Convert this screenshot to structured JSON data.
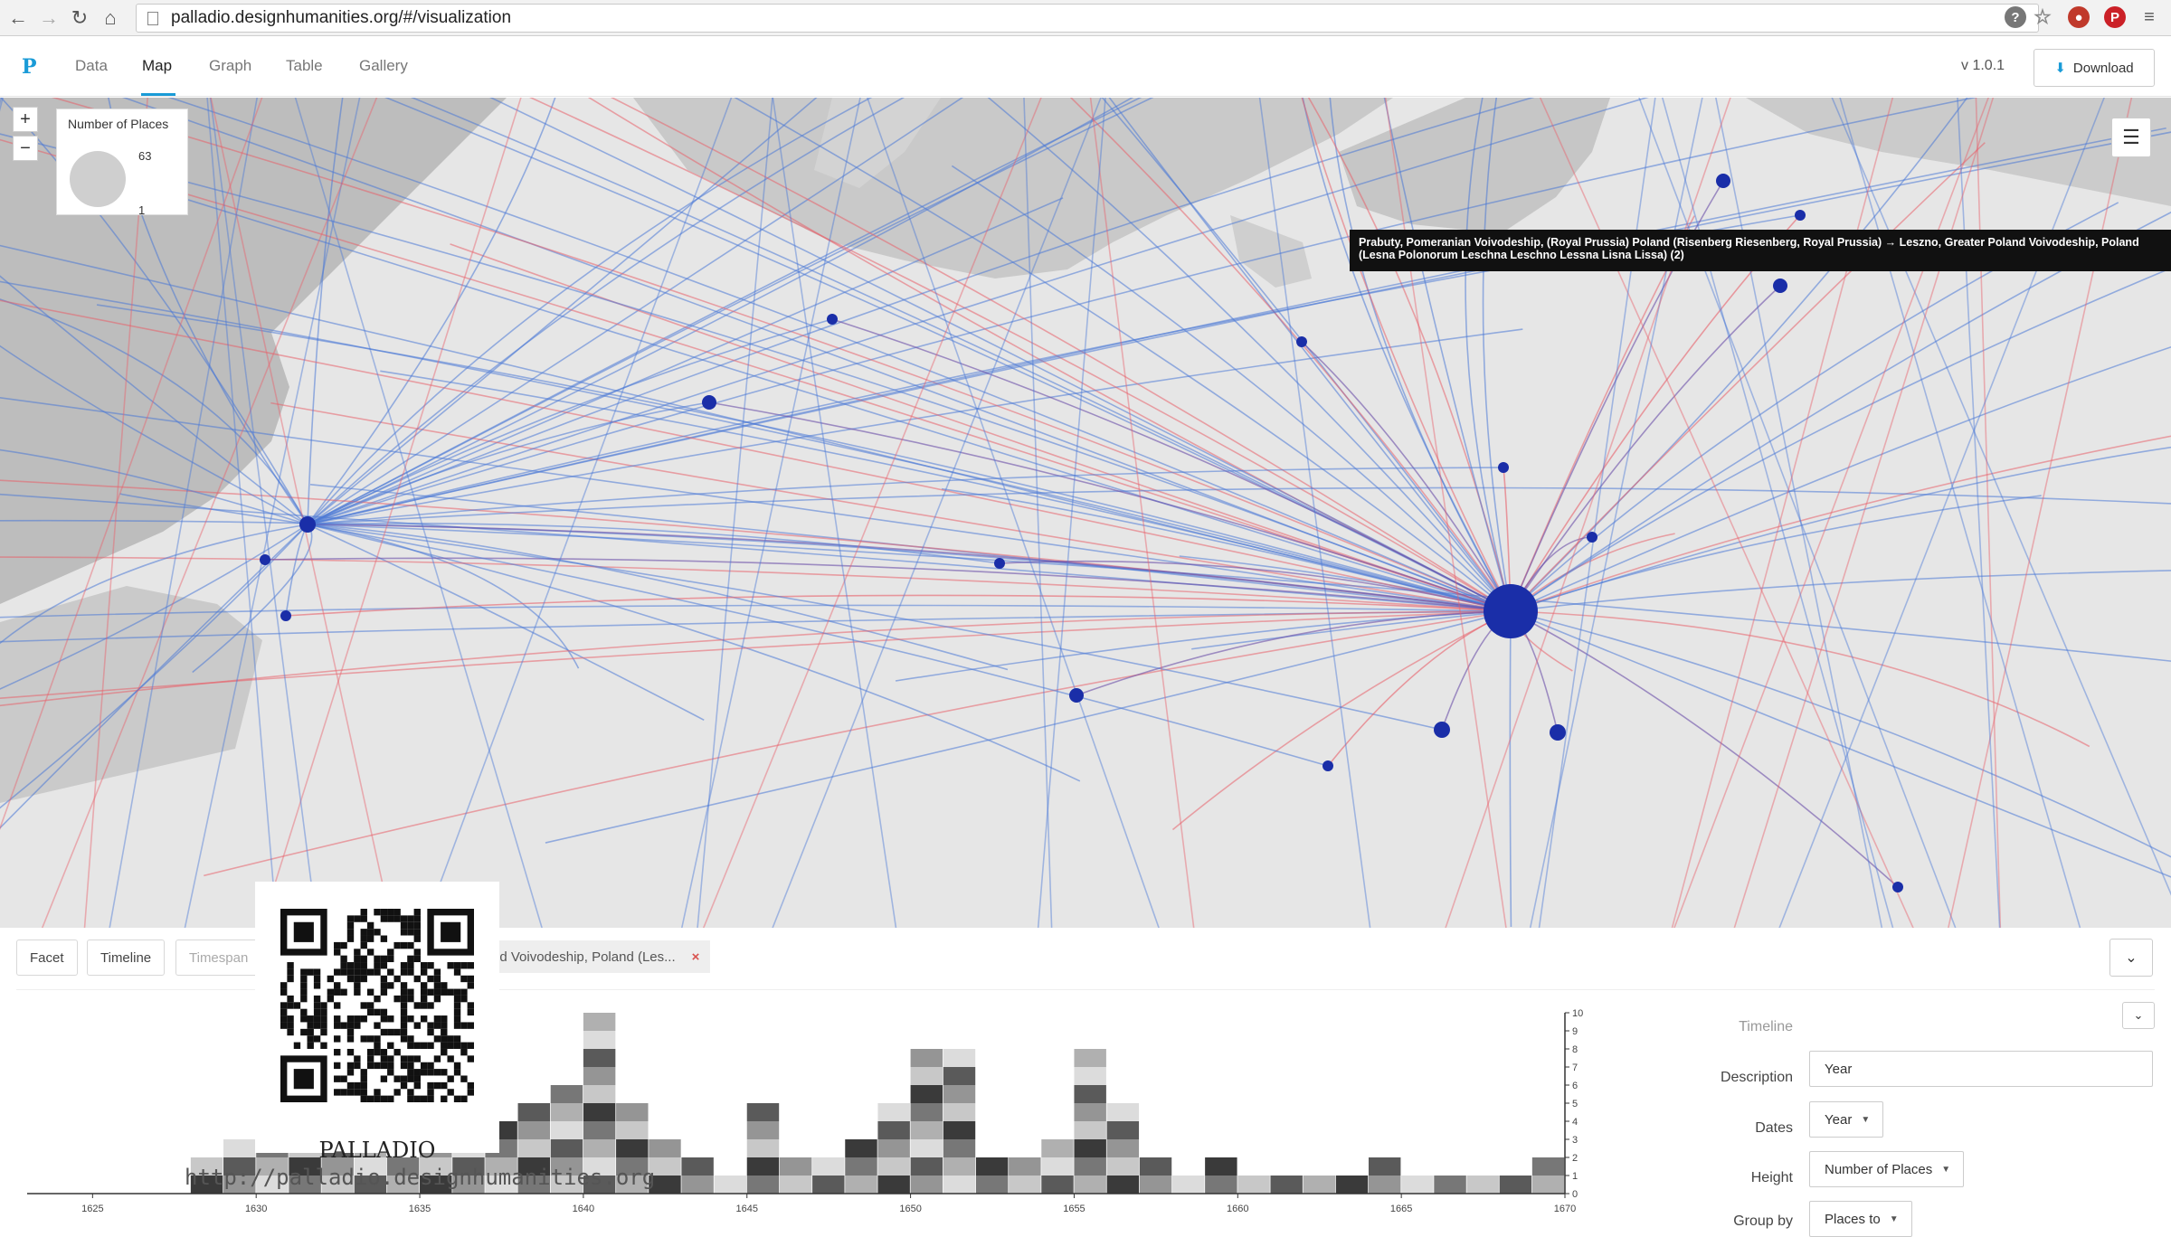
{
  "browser": {
    "url": "palladio.designhumanities.org/#/visualization",
    "back_icon": "arrow-left-icon",
    "forward_icon": "arrow-right-icon",
    "reload_icon": "reload-icon",
    "home_icon": "home-icon"
  },
  "app": {
    "logo": "P",
    "tabs": [
      {
        "label": "Data"
      },
      {
        "label": "Map"
      },
      {
        "label": "Graph"
      },
      {
        "label": "Table"
      },
      {
        "label": "Gallery"
      }
    ],
    "active_tab": "Map",
    "version": "v 1.0.1",
    "download_label": "Download",
    "accent_color": "#1a9bd7"
  },
  "map": {
    "zoom_in": "+",
    "zoom_out": "−",
    "legend": {
      "title": "Number of Places",
      "max": "63",
      "min": "1"
    },
    "tooltip": "Prabuty, Pomeranian Voivodeship, (Royal Prussia) Poland (Risenberg Riesenberg, Royal Prussia) → Leszno, Greater Poland Voivodeship, Poland (Lesna Polonorum Leschna Leschno Lessna Lisna Lissa) (2)",
    "node_color": "#1a2ea8",
    "link_color_blue": "#4a78d6",
    "link_color_red": "#e8606a"
  },
  "panel": {
    "tabs": [
      {
        "label": "Facet"
      },
      {
        "label": "Timeline"
      },
      {
        "label": "Timespan"
      }
    ],
    "filter_chip": "nd Voivodeship, Poland (Les...",
    "filter_close": "×",
    "settings": {
      "timeline_label": "Timeline",
      "description_label": "Description",
      "description_value": "Year",
      "dates_label": "Dates",
      "dates_value": "Year",
      "height_label": "Height",
      "height_value": "Number of Places",
      "group_by_label": "Group by",
      "group_by_value": "Places to"
    }
  },
  "chart_data": {
    "type": "bar",
    "x_ticks": [
      "1625",
      "1630",
      "1635",
      "1640",
      "1645",
      "1650",
      "1655",
      "1660",
      "1665",
      "1670"
    ],
    "y_ticks": [
      "0",
      "1",
      "2",
      "3",
      "4",
      "5",
      "6",
      "7",
      "8",
      "9",
      "10"
    ],
    "xlim": [
      1623,
      1670
    ],
    "ylim": [
      0,
      10
    ],
    "x": [
      1628,
      1629,
      1630,
      1631,
      1632,
      1633,
      1634,
      1635,
      1636,
      1637,
      1638,
      1639,
      1640,
      1641,
      1642,
      1643,
      1644,
      1645,
      1646,
      1647,
      1648,
      1649,
      1650,
      1651,
      1652,
      1653,
      1654,
      1655,
      1656,
      1657,
      1658,
      1659,
      1660,
      1661,
      1662,
      1663,
      1664,
      1665,
      1666,
      1667,
      1668,
      1669
    ],
    "values": [
      2,
      3,
      6,
      6,
      5,
      3,
      2,
      3,
      3,
      4,
      5,
      6,
      10,
      5,
      3,
      2,
      1,
      5,
      2,
      2,
      3,
      5,
      8,
      8,
      2,
      2,
      3,
      8,
      5,
      2,
      1,
      2,
      1,
      1,
      1,
      1,
      2,
      1,
      1,
      1,
      1,
      2
    ]
  },
  "overlay": {
    "title": "PALLADIO",
    "url": "http://palladio.designhumanities.org"
  }
}
